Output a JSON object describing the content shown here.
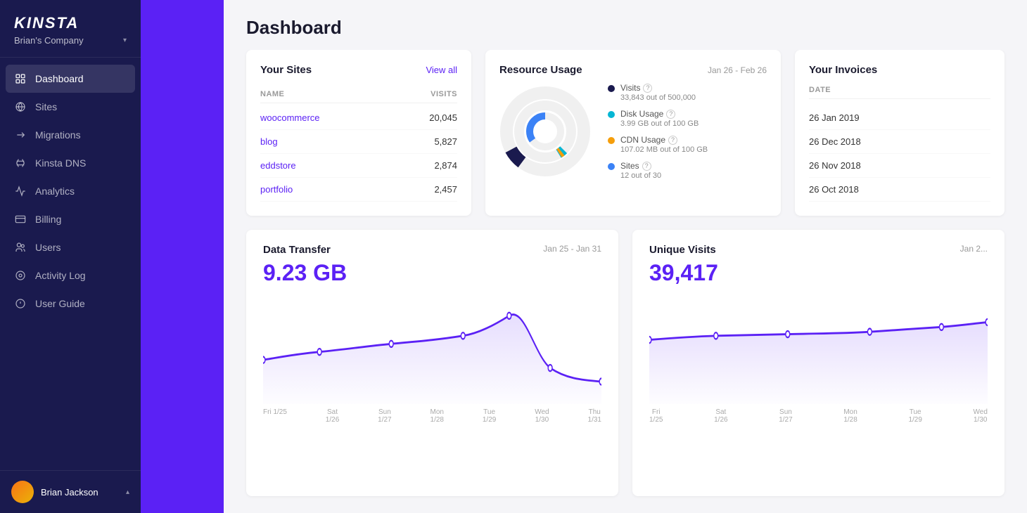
{
  "sidebar": {
    "logo": "KINSTA",
    "company": "Brian's Company",
    "nav": [
      {
        "id": "dashboard",
        "label": "Dashboard",
        "active": true
      },
      {
        "id": "sites",
        "label": "Sites",
        "active": false
      },
      {
        "id": "migrations",
        "label": "Migrations",
        "active": false
      },
      {
        "id": "kinsta-dns",
        "label": "Kinsta DNS",
        "active": false
      },
      {
        "id": "analytics",
        "label": "Analytics",
        "active": false
      },
      {
        "id": "billing",
        "label": "Billing",
        "active": false
      },
      {
        "id": "users",
        "label": "Users",
        "active": false
      },
      {
        "id": "activity-log",
        "label": "Activity Log",
        "active": false
      },
      {
        "id": "user-guide",
        "label": "User Guide",
        "active": false
      }
    ],
    "user": {
      "name": "Brian Jackson"
    }
  },
  "header": {
    "title": "Dashboard"
  },
  "sites_card": {
    "title": "Your Sites",
    "view_all": "View all",
    "col_name": "NAME",
    "col_visits": "VISITS",
    "sites": [
      {
        "name": "woocommerce",
        "visits": "20,045"
      },
      {
        "name": "blog",
        "visits": "5,827"
      },
      {
        "name": "eddstore",
        "visits": "2,874"
      },
      {
        "name": "portfolio",
        "visits": "2,457"
      }
    ]
  },
  "resource_card": {
    "title": "Resource Usage",
    "date_range": "Jan 26 - Feb 26",
    "legend": [
      {
        "id": "visits",
        "label": "Visits",
        "value": "33,843 out of 500,000",
        "color": "#1a1a4e"
      },
      {
        "id": "disk",
        "label": "Disk Usage",
        "value": "3.99 GB out of 100 GB",
        "color": "#06b6d4"
      },
      {
        "id": "cdn",
        "label": "CDN Usage",
        "value": "107.02 MB out of 100 GB",
        "color": "#f59e0b"
      },
      {
        "id": "sites",
        "label": "Sites",
        "value": "12 out of 30",
        "color": "#3b82f6"
      }
    ]
  },
  "invoices_card": {
    "title": "Your Invoices",
    "col_date": "DATE",
    "dates": [
      "26 Jan 2019",
      "26 Dec 2018",
      "26 Nov 2018",
      "26 Oct 2018"
    ]
  },
  "data_transfer_card": {
    "title": "Data Transfer",
    "date_range": "Jan 25 - Jan 31",
    "value": "9.23 GB",
    "x_labels": [
      "Fri\n1/25",
      "Sat\n1/26",
      "Sun\n1/27",
      "Mon\n1/28",
      "Tue\n1/29",
      "Wed\n1/30",
      "Thu\n1/31"
    ]
  },
  "unique_visits_card": {
    "title": "Unique Visits",
    "date_range": "Jan 2...",
    "value": "39,417",
    "x_labels": [
      "Fri\n1/25",
      "Sat\n1/26",
      "Sun\n1/27",
      "Mon\n1/28",
      "Tue\n1/29",
      "Wed\n1/30"
    ]
  }
}
